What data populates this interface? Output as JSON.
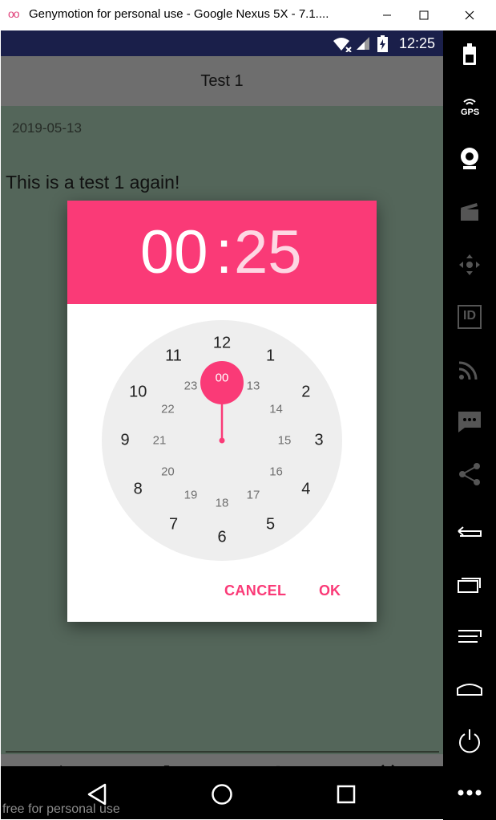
{
  "window": {
    "logo": "oo",
    "title": "Genymotion for personal use - Google Nexus 5X - 7.1....",
    "controls": [
      "minimize-icon",
      "maximize-icon",
      "close-icon"
    ]
  },
  "statusbar": {
    "time": "12:25",
    "icons": [
      "wifi-icon",
      "signal-icon",
      "battery-charging-icon"
    ]
  },
  "app": {
    "title": "Test 1",
    "date": "2019-05-13",
    "note": "This is a test 1 again!",
    "background": "#54665a",
    "bottom_actions": [
      "edit-icon",
      "delete-icon",
      "settings-icon",
      "alarm-icon"
    ]
  },
  "dialog": {
    "hours": "00",
    "separator": ":",
    "minutes": "25",
    "accent": "#fa3a77",
    "selected": "00",
    "outer_numbers": [
      "12",
      "1",
      "2",
      "3",
      "4",
      "5",
      "6",
      "7",
      "8",
      "9",
      "10",
      "11"
    ],
    "inner_numbers": [
      "00",
      "13",
      "14",
      "15",
      "16",
      "17",
      "18",
      "19",
      "20",
      "21",
      "22",
      "23"
    ],
    "cancel": "CANCEL",
    "ok": "OK"
  },
  "navbar": {
    "icons": [
      "back-icon",
      "home-icon",
      "recents-icon"
    ]
  },
  "watermark": "free for personal use",
  "sidebar": {
    "tools": [
      "battery-icon",
      "gps-icon",
      "camera-icon",
      "capture-icon",
      "remote-control-icon",
      "identifiers-icon",
      "network-icon",
      "sms-icon",
      "share-icon",
      "back-icon",
      "recents-icon",
      "menu-icon",
      "home-icon",
      "power-icon",
      "more-icon"
    ],
    "gps_label": "GPS",
    "id_label": "ID"
  }
}
